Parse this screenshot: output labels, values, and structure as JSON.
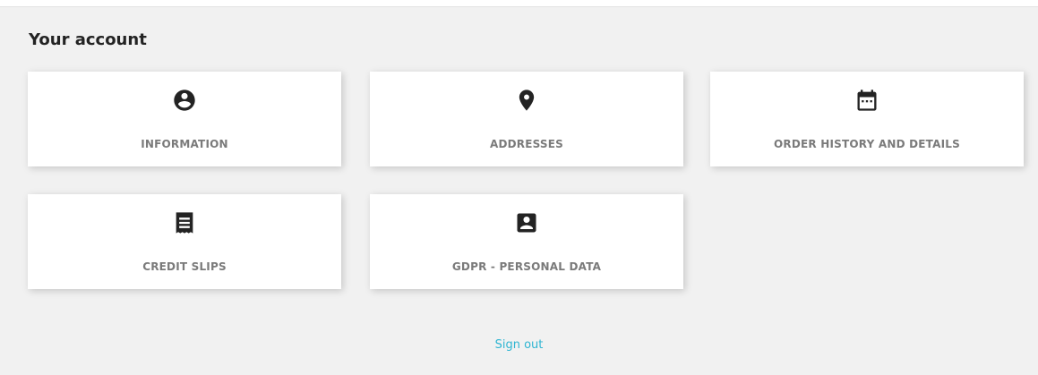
{
  "account": {
    "title": "Your account",
    "cards": [
      {
        "label": "INFORMATION",
        "icon": "account-circle-icon"
      },
      {
        "label": "ADDRESSES",
        "icon": "location-pin-icon"
      },
      {
        "label": "ORDER HISTORY AND DETAILS",
        "icon": "calendar-icon"
      },
      {
        "label": "CREDIT SLIPS",
        "icon": "receipt-icon"
      },
      {
        "label": "GDPR - PERSONAL DATA",
        "icon": "account-box-icon"
      }
    ],
    "sign_out": "Sign out"
  },
  "colors": {
    "background": "#f1f1f1",
    "card": "#ffffff",
    "label": "#7a7a7a",
    "icon": "#232323",
    "link": "#2fb5d2"
  }
}
